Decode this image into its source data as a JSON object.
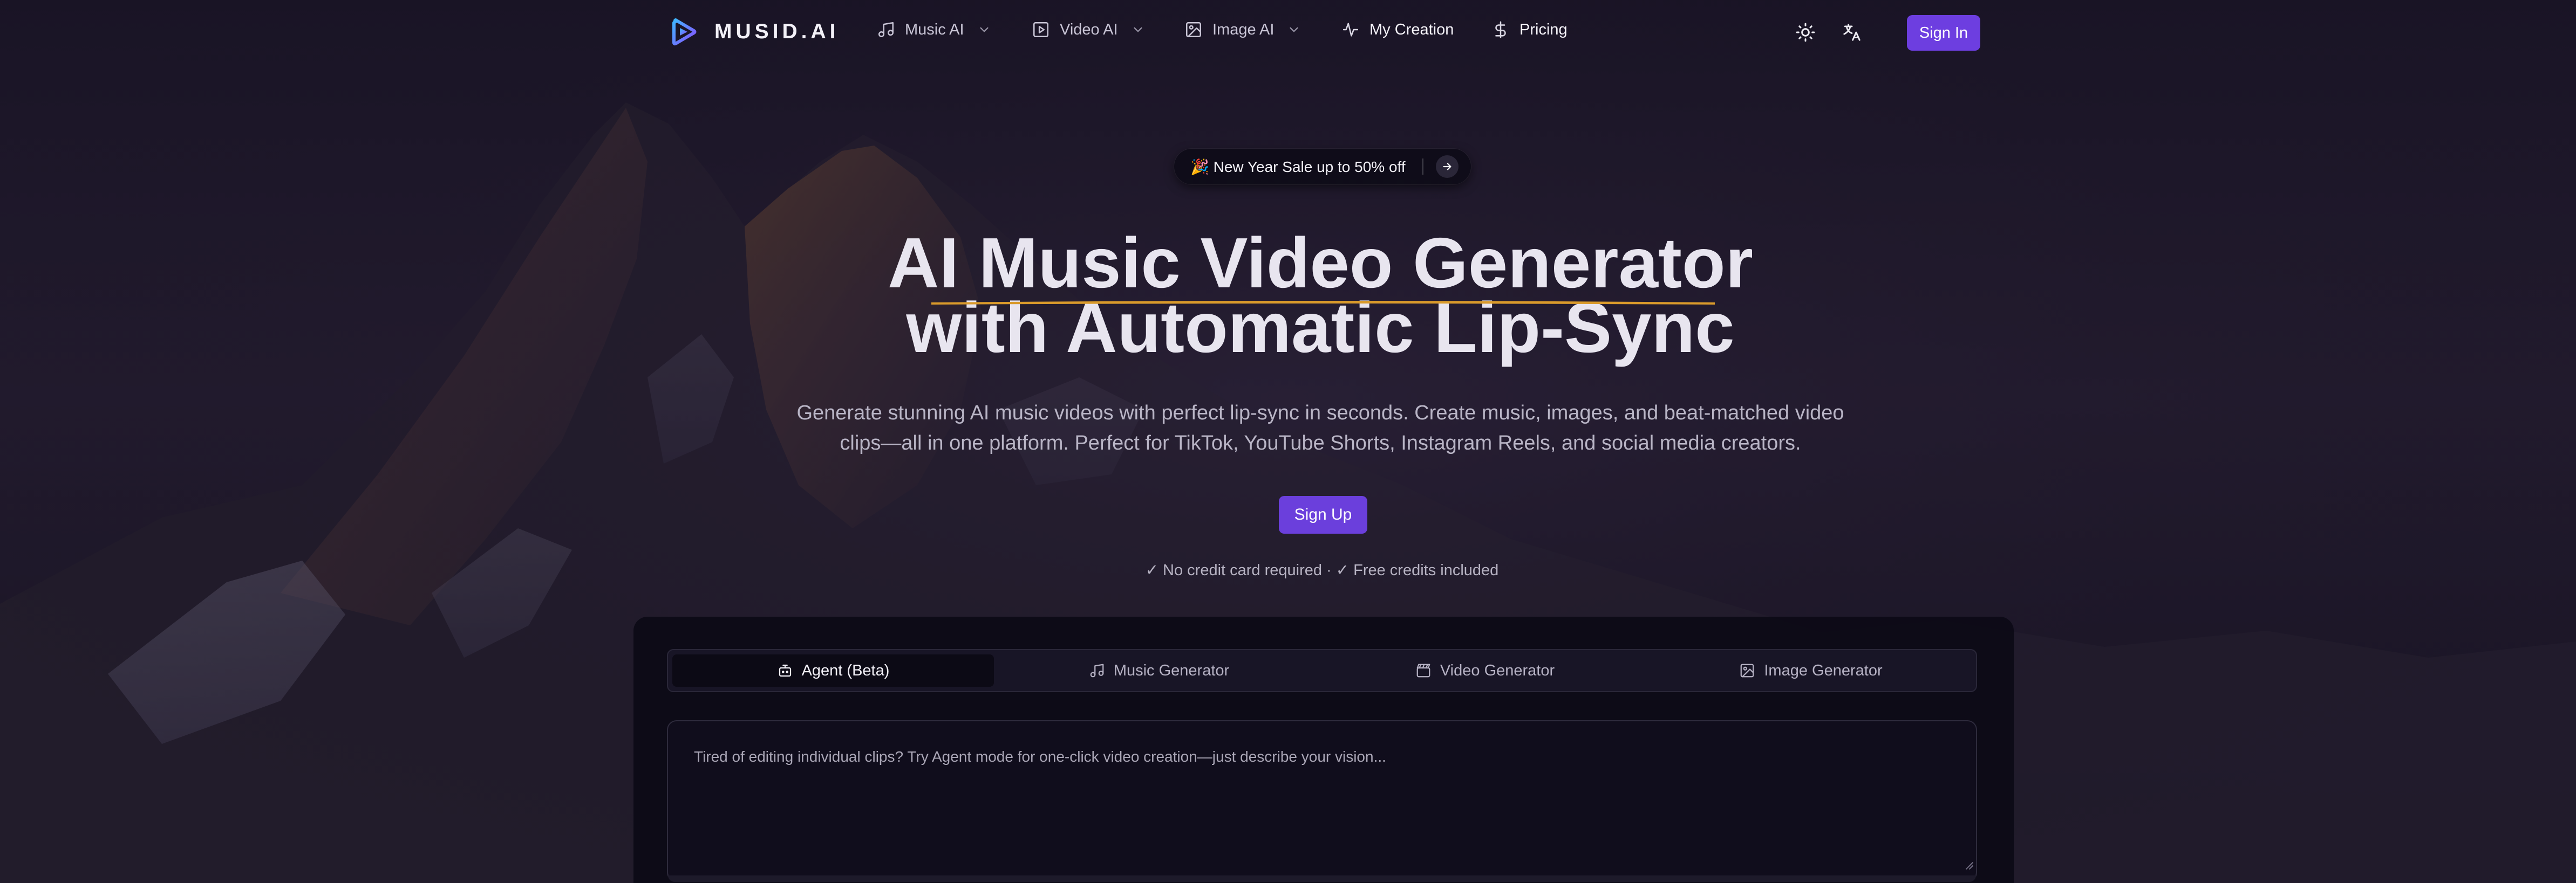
{
  "brand": {
    "name": "MUSID.AI",
    "logo_icon": "play-triangle-logo",
    "accent_color": "#6d3ee0"
  },
  "nav": {
    "items": [
      {
        "label": "Music AI",
        "icon": "music-note-icon",
        "has_dropdown": true
      },
      {
        "label": "Video AI",
        "icon": "video-play-icon",
        "has_dropdown": true
      },
      {
        "label": "Image AI",
        "icon": "image-icon",
        "has_dropdown": true
      },
      {
        "label": "My Creation",
        "icon": "activity-icon",
        "has_dropdown": false
      },
      {
        "label": "Pricing",
        "icon": "dollar-icon",
        "has_dropdown": false
      }
    ],
    "theme_icon": "sun-icon",
    "language_icon": "translate-icon",
    "sign_in_label": "Sign In"
  },
  "hero": {
    "promo_text": "🎉 New Year Sale up to 50% off",
    "title_line1": "AI Music Video Generator",
    "title_line2": "with Automatic Lip-Sync",
    "underline_color": "#e0a030",
    "subtitle": "Generate stunning AI music videos with perfect lip-sync in seconds. Create music, images, and beat-matched video clips—all in one platform. Perfect for TikTok, YouTube Shorts, Instagram Reels, and social media creators.",
    "signup_label": "Sign Up",
    "note": "✓ No credit card required · ✓ Free credits included"
  },
  "generator": {
    "tabs": [
      {
        "label": "Agent (Beta)",
        "icon": "robot-icon",
        "active": true
      },
      {
        "label": "Music Generator",
        "icon": "music-note-icon",
        "active": false
      },
      {
        "label": "Video Generator",
        "icon": "clapperboard-icon",
        "active": false
      },
      {
        "label": "Image Generator",
        "icon": "image-icon",
        "active": false
      }
    ],
    "prompt_placeholder": "Tired of editing individual clips? Try Agent mode for one-click video creation—just describe your vision...",
    "prompt_value": ""
  }
}
